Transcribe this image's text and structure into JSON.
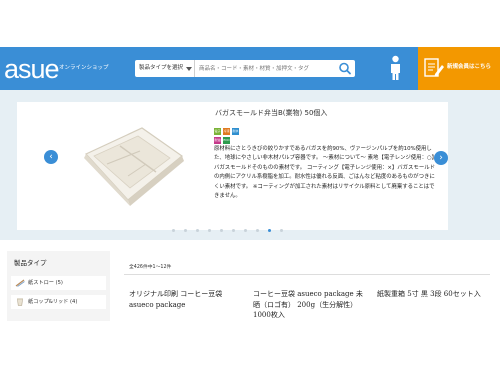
{
  "header": {
    "logo": "asue",
    "logo_sub": "オンラインショップ",
    "search": {
      "category_label": "製品タイプを選択",
      "placeholder": "商品名・コード・素材・材質・加押文・タグ"
    },
    "member_label": "新規会員はこちら"
  },
  "banner": {
    "product_title": "バガスモールド弁当B(業物) 50個入",
    "description": "原材料にさとうきびの絞りかすであるバガスを約90%、ヴァージンパルプを約10%使用した、地球にやさしい非木材パルプ容器です。 〜素材について〜 素地【電子レンジ使用：○】バガスモールドそのものの素材です。 コーティング【電子レンジ使用：×】バガスモールドの内側にアクリル系樹脂を加工。耐水性は優れる反面、ごはんなど粘度のあるものがつきにくい素材です。 ※コーティングが加工された素材はリサイクル原料として廃棄することはできません。",
    "badges": [
      "電子レンジ",
      "冷凍",
      "耐水",
      "耐油",
      "ECO"
    ],
    "prev": "‹",
    "next": "›",
    "slide_count": 10,
    "active_slide": 8
  },
  "sidebar": {
    "title": "製品タイプ",
    "items": [
      {
        "label": "紙ストロー (5)"
      },
      {
        "label": "紙コップ&リッド (4)"
      }
    ]
  },
  "results": {
    "count_text": "全426件中1〜12件",
    "products": [
      {
        "title": "オリジナル印刷 コーヒー豆袋 asueco package"
      },
      {
        "title": "コーヒー豆袋 asueco package 未晒（ロゴ有） 200g（生分解性）1000枚入"
      },
      {
        "title": "紙製重箱 5寸 黒 3段 60セット入"
      }
    ]
  },
  "colors": {
    "header_blue": "#3a8ed6",
    "member_orange": "#f39800",
    "banner_bg": "#e6eff4"
  }
}
